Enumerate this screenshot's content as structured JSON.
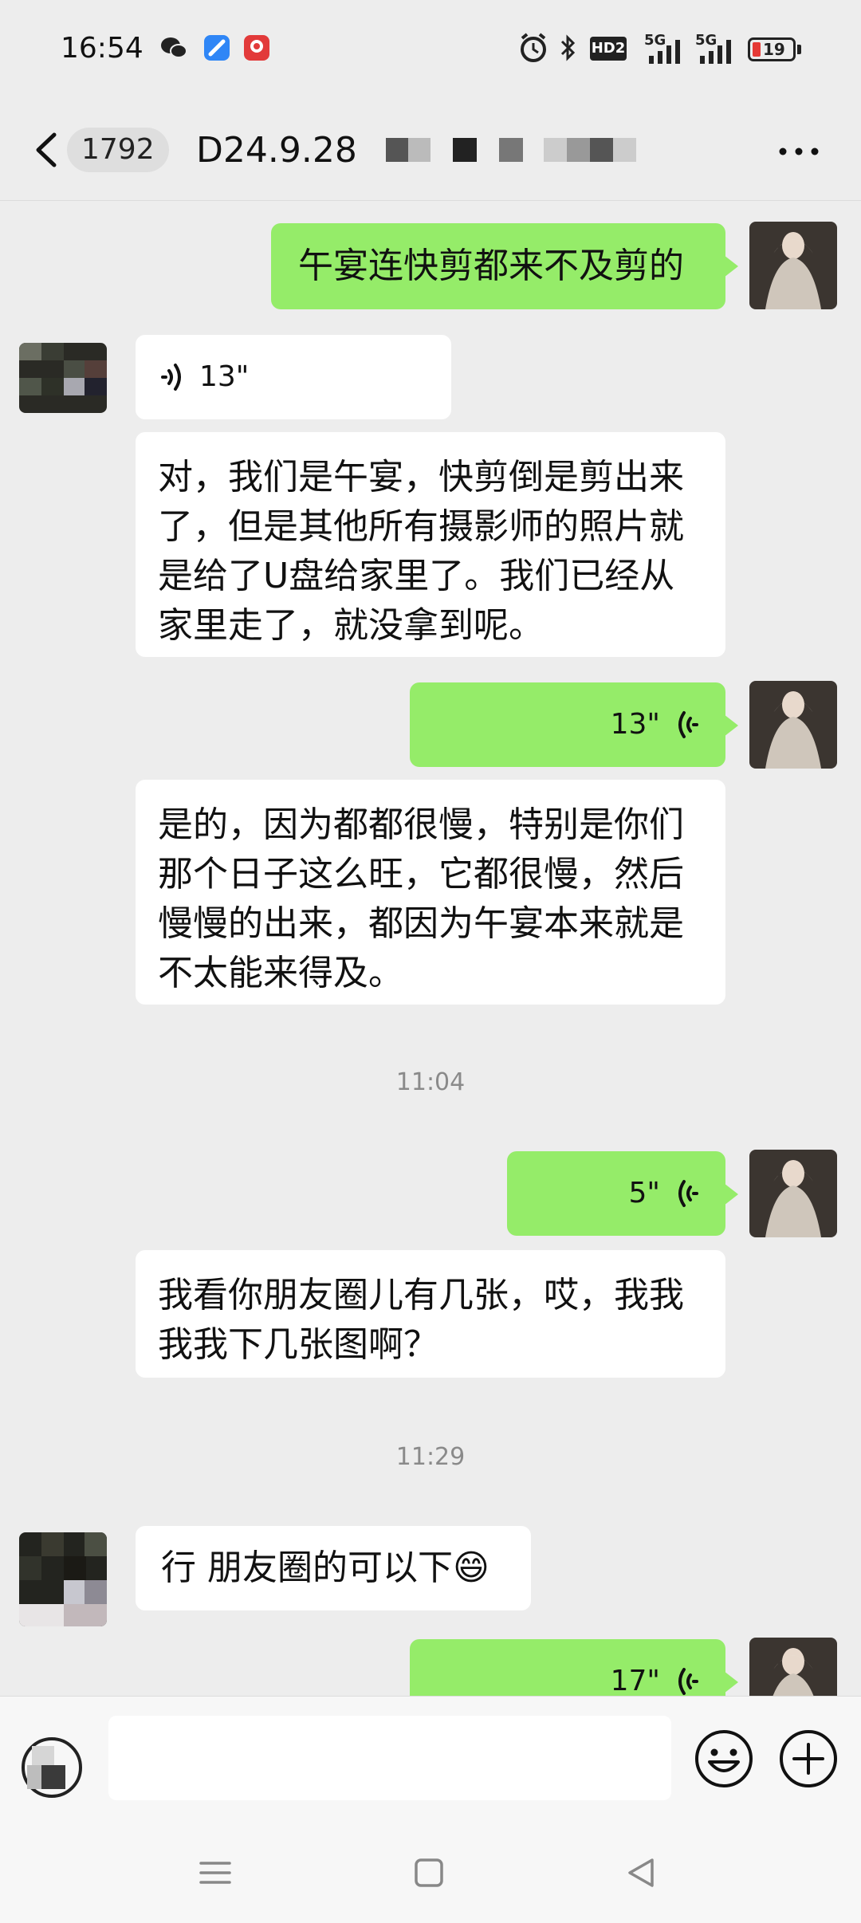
{
  "status_bar": {
    "time": "16:54",
    "battery": "19",
    "hd_label": "HD2",
    "signal_label_1": "5G",
    "signal_label_2": "5G"
  },
  "header": {
    "unread_count": "1792",
    "title": "D24.9.28"
  },
  "messages": [
    {
      "side": "out",
      "type": "text",
      "text": "午宴连快剪都来不及剪的"
    },
    {
      "side": "in",
      "type": "voice",
      "duration": "13\""
    },
    {
      "side": "in",
      "type": "text",
      "lines": [
        "对，我们是午宴，快剪倒是剪出来",
        "了，但是其他所有摄影师的照片就",
        "是给了U盘给家里了。我们已经从",
        "家里走了，就没拿到呢。"
      ]
    },
    {
      "side": "out",
      "type": "voice",
      "duration": "13\""
    },
    {
      "side": "in",
      "type": "text",
      "lines": [
        "是的，因为都都很慢，特别是你们",
        "那个日子这么旺，它都很慢，然后",
        "慢慢的出来，都因为午宴本来就是",
        "不太能来得及。"
      ]
    },
    {
      "type": "time",
      "text": "11:04"
    },
    {
      "side": "out",
      "type": "voice",
      "duration": "5\""
    },
    {
      "side": "in",
      "type": "text",
      "lines": [
        "我看你朋友圈儿有几张，哎，我我",
        "我我下几张图啊？"
      ]
    },
    {
      "type": "time",
      "text": "11:29"
    },
    {
      "side": "in",
      "type": "text",
      "text": "行 朋友圈的可以下",
      "emoji": "😄"
    },
    {
      "side": "out",
      "type": "voice",
      "duration": "17\""
    }
  ],
  "colors": {
    "background": "#ededed",
    "outgoing_bubble": "#95ec69",
    "incoming_bubble": "#ffffff"
  },
  "icons": {
    "back": "chevron-left-icon",
    "more": "more-dots-icon",
    "voice_toggle": "voice-mode-icon",
    "emoji": "emoji-smile-icon",
    "plus": "plus-circle-icon",
    "nav_menu": "menu-icon",
    "nav_home": "home-square-icon",
    "nav_back": "back-triangle-icon"
  }
}
